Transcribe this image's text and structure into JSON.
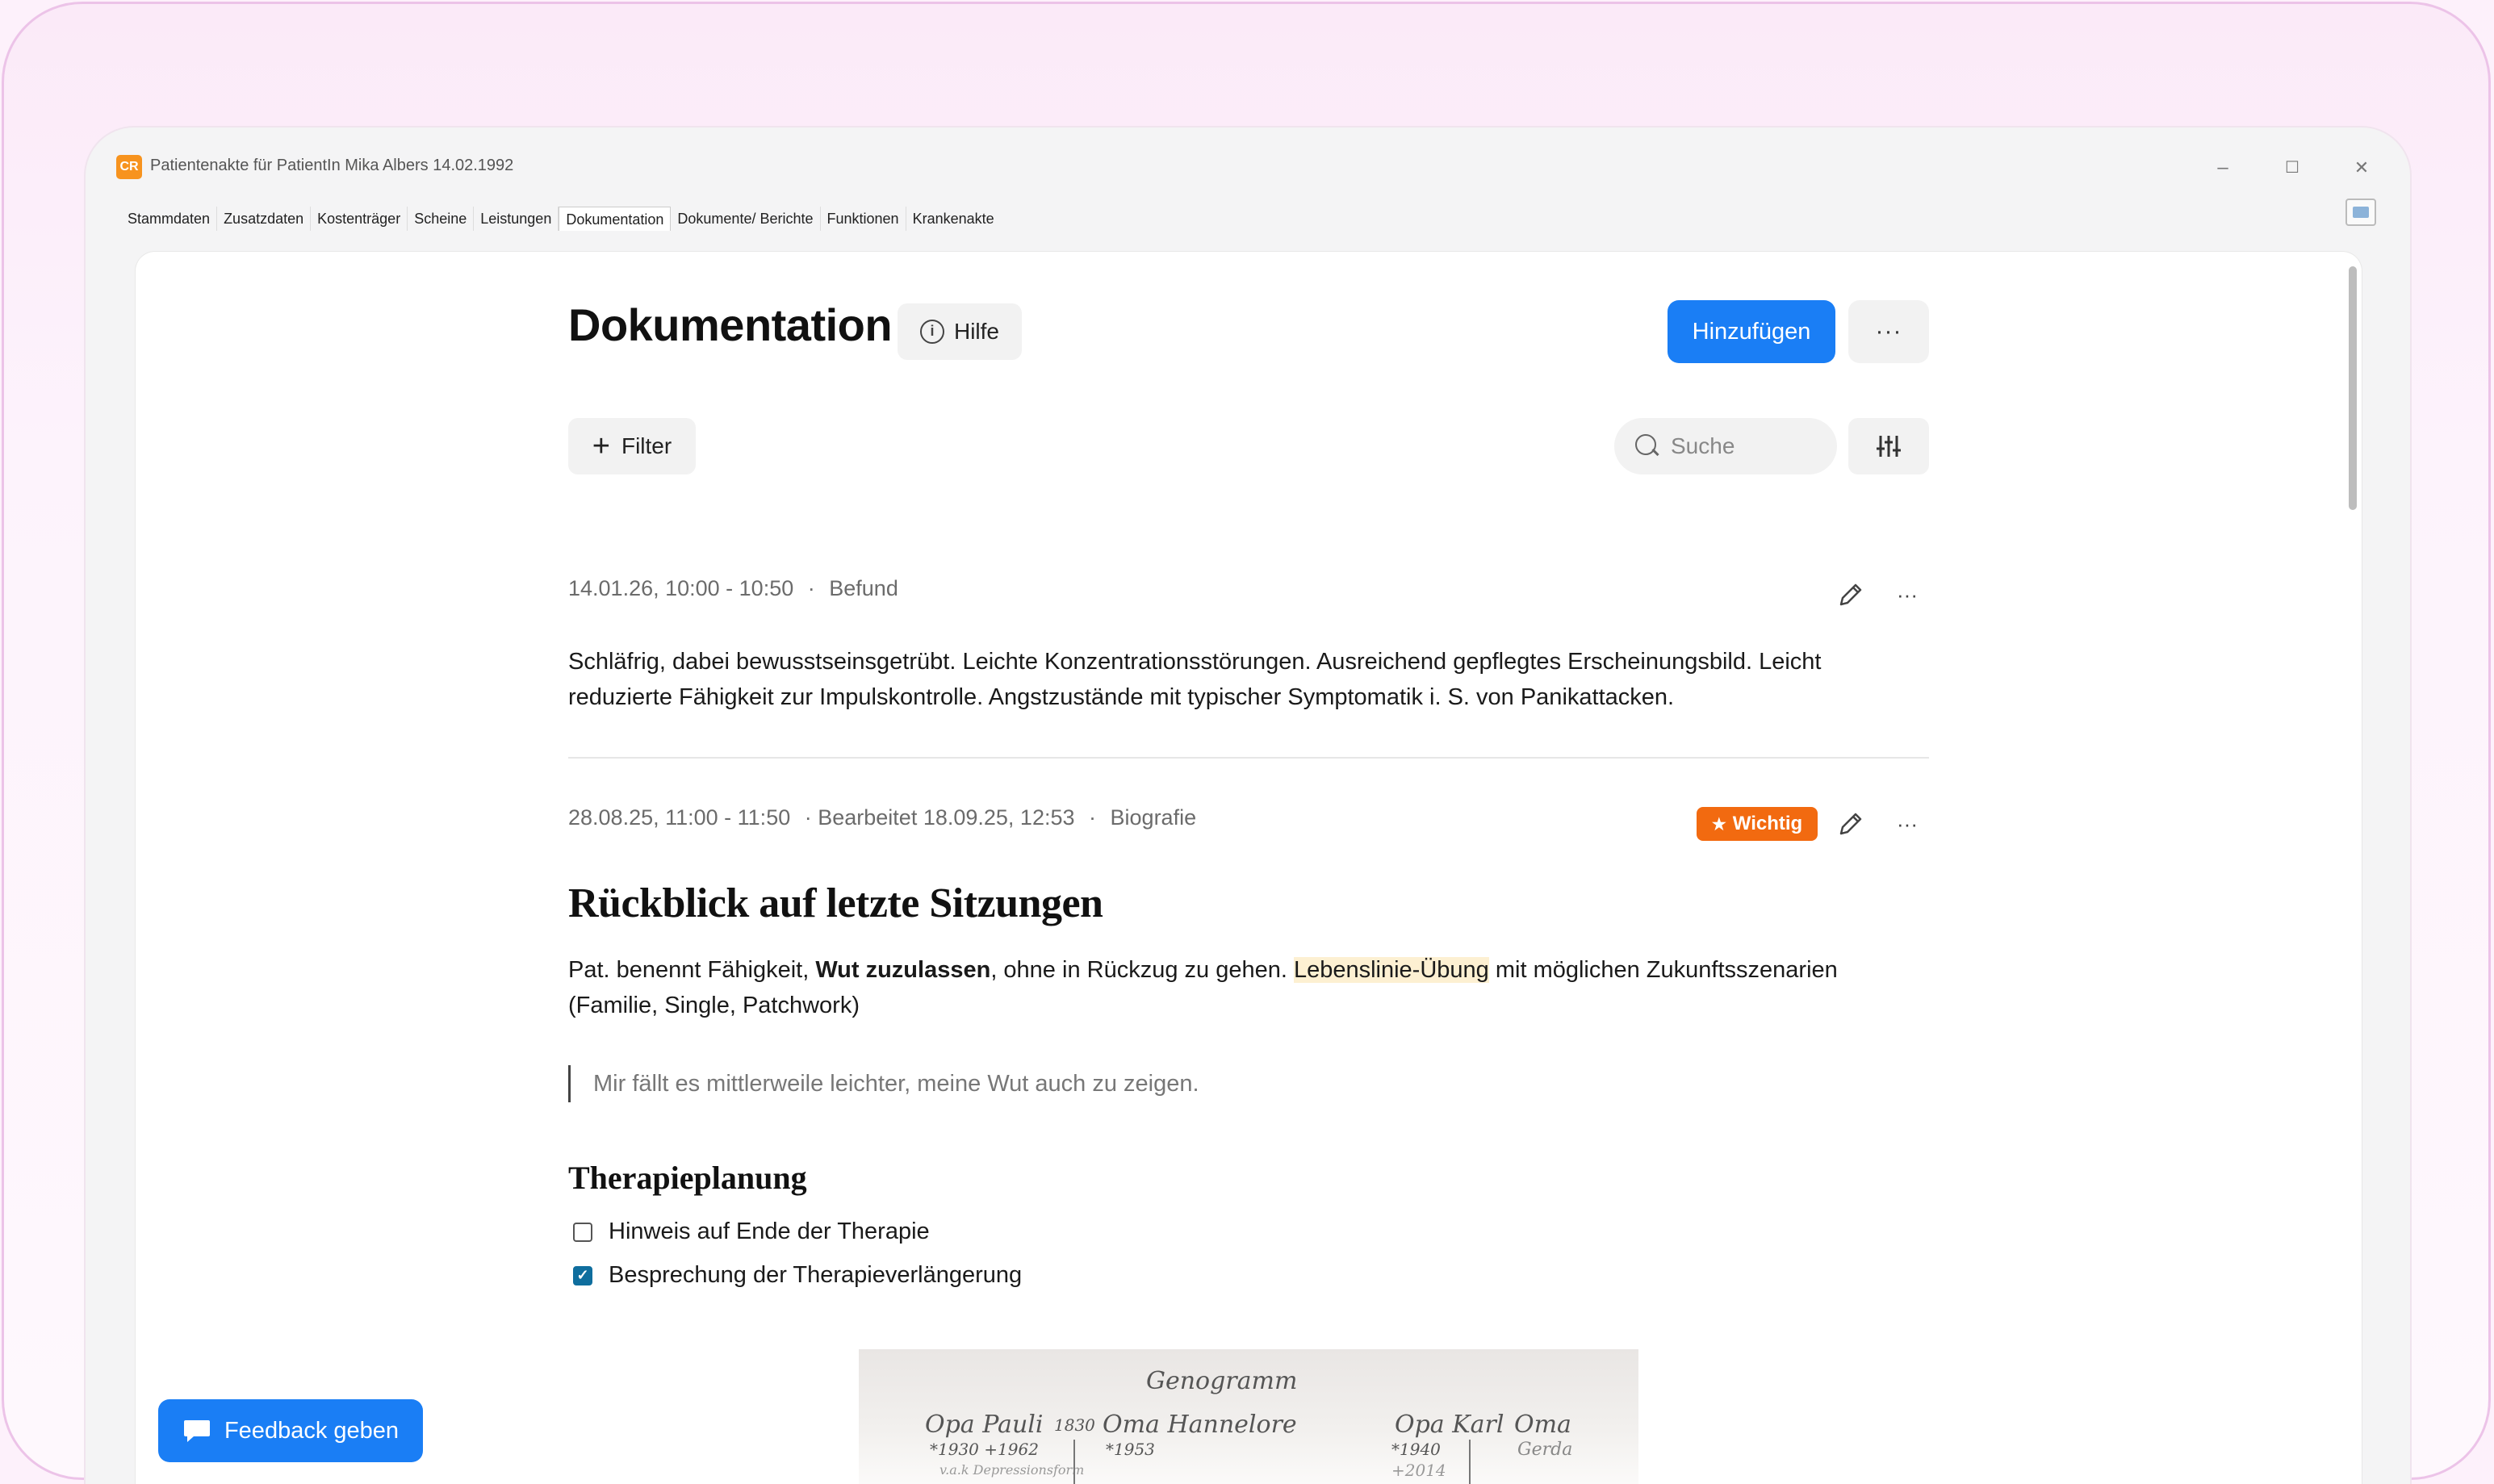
{
  "window": {
    "title": "Patientenakte für PatientIn Mika Albers 14.02.1992",
    "app_icon_label": "CR",
    "minimize": "–",
    "maximize": "☐",
    "close": "✕"
  },
  "menu": {
    "items": [
      {
        "label": "Stammdaten"
      },
      {
        "label": "Zusatzdaten"
      },
      {
        "label": "Kostenträger"
      },
      {
        "label": "Scheine"
      },
      {
        "label": "Leistungen"
      },
      {
        "label": "Dokumentation",
        "active": true
      },
      {
        "label": "Dokumente/ Berichte"
      },
      {
        "label": "Funktionen"
      },
      {
        "label": "Krankenakte"
      }
    ]
  },
  "page": {
    "title": "Dokumentation",
    "help_label": "Hilfe",
    "add_label": "Hinzufügen",
    "more_label": "···",
    "filter_label": "Filter",
    "search_placeholder": "Suche"
  },
  "entries": [
    {
      "date": "14.01.26, 10:00 - 10:50",
      "sep": "·",
      "category": "Befund",
      "text_line1": "Schläfrig, dabei bewusstseinsgetrübt. Leichte Konzentrationsstörungen. Ausreichend gepflegtes Erscheinungsbild. Leicht",
      "text_line2": "reduzierte Fähigkeit zur Impulskontrolle. Angstzustände mit typischer Symptomatik i. S. von Panikattacken."
    },
    {
      "date": "28.08.25, 11:00 - 11:50",
      "edited": "· Bearbeitet 18.09.25, 12:53",
      "sep": "·",
      "category": "Biografie",
      "badge": "Wichtig",
      "heading": "Rückblick auf letzte Sitzungen",
      "para_part1": "Pat. benennt Fähigkeit, ",
      "para_bold": "Wut zuzulassen",
      "para_part2": ", ohne in Rückzug zu gehen. ",
      "para_highlight": "Lebenslinie-Übung",
      "para_part3": " mit möglichen Zukunftsszenarien",
      "para_line2": "(Familie, Single, Patchwork)",
      "quote": "Mir fällt es mittlerweile leichter, meine Wut auch zu zeigen.",
      "section_heading": "Therapieplanung",
      "checklist": [
        {
          "label": "Hinweis auf Ende der Therapie",
          "checked": false
        },
        {
          "label": "Besprechung der Therapieverlängerung",
          "checked": true
        }
      ],
      "image": {
        "title": "Genogramm",
        "left_pair": "Opa Pauli",
        "left_year": "1830",
        "left_partner": "Oma Hannelore",
        "left_dates": "*1930  +1962",
        "left_partner_date": "*1953",
        "left_note": "v.a.k Depressionsform",
        "right_pair": "Opa Karl",
        "right_partner": "Oma",
        "right_partner_name": "Gerda",
        "right_dates": "*1940",
        "right_dates2": "+2014"
      }
    }
  ],
  "feedback": {
    "label": "Feedback geben"
  },
  "colors": {
    "primary": "#1a7ef5",
    "badge": "#f26a10",
    "highlight": "#fdf0d2",
    "checkbox_checked": "#0f6e9e"
  }
}
